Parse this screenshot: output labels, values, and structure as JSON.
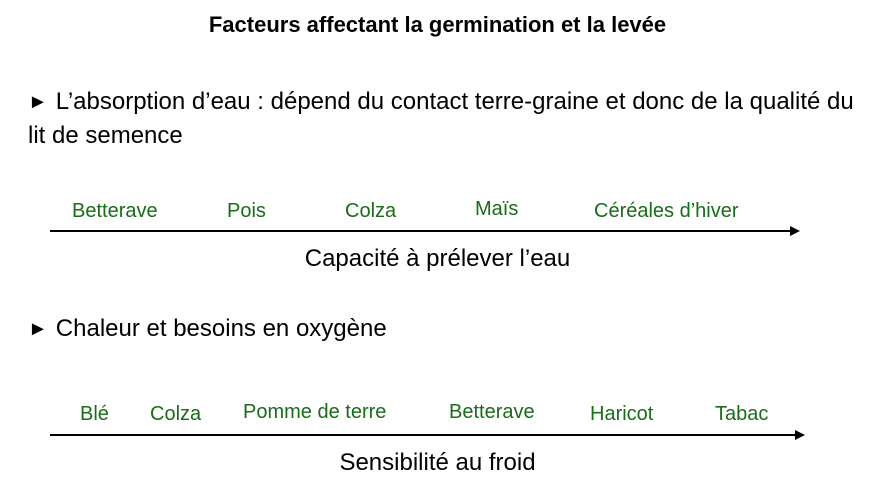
{
  "title": "Facteurs affectant la germination et la levée",
  "colors": {
    "scale_label": "#1a6b1a",
    "text": "#000000",
    "background": "#ffffff"
  },
  "bullet_marker": "►",
  "point1": {
    "text": "L’absorption d’eau : dépend du contact terre-graine et donc de la qualité du lit de semence",
    "scale": {
      "items": [
        "Betterave",
        "Pois",
        "Colza",
        "Maïs",
        "Céréales d’hiver"
      ],
      "caption": "Capacité à prélever l’eau"
    }
  },
  "point2": {
    "text": "Chaleur et besoins en oxygène",
    "scale": {
      "items": [
        "Blé",
        "Colza",
        "Pomme de terre",
        "Betterave",
        "Haricot",
        "Tabac"
      ],
      "caption": "Sensibilité au froid"
    }
  }
}
